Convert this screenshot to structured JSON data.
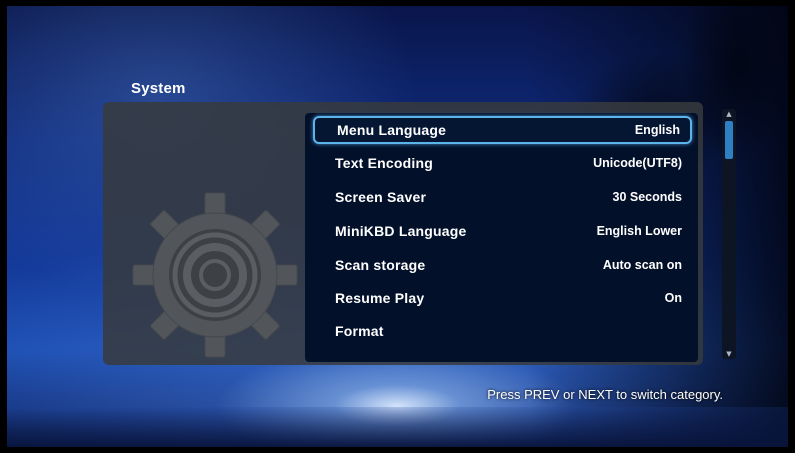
{
  "page": {
    "title": "System",
    "hint": "Press PREV or NEXT to switch category."
  },
  "menu": {
    "selected_index": 0,
    "items": [
      {
        "label": "Menu Language",
        "value": "English"
      },
      {
        "label": "Text Encoding",
        "value": "Unicode(UTF8)"
      },
      {
        "label": "Screen Saver",
        "value": "30 Seconds"
      },
      {
        "label": "MiniKBD Language",
        "value": "English Lower"
      },
      {
        "label": "Scan storage",
        "value": "Auto scan on"
      },
      {
        "label": "Resume Play",
        "value": "On"
      },
      {
        "label": "Format",
        "value": ""
      }
    ]
  },
  "icons": {
    "category": "gear-icon",
    "scroll_up": "triangle-up-icon",
    "scroll_down": "triangle-down-icon"
  },
  "colors": {
    "selection_border": "#5bb4ea",
    "list_background": "#03102a",
    "panel_background": "#373a3e",
    "scroll_thumb": "#2f7fc4"
  }
}
